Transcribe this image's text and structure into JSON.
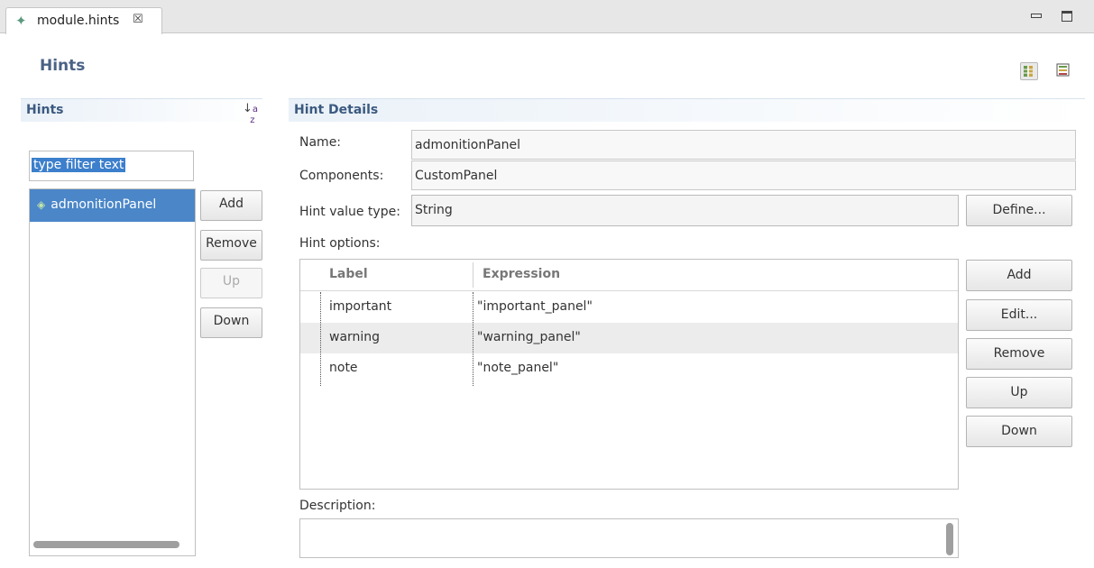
{
  "tab": {
    "icon": "diamond-icon",
    "label": "module.hints",
    "close_glyph": "☒"
  },
  "window_controls": {
    "minimize": "minimize-icon",
    "maximize": "maximize-icon"
  },
  "page": {
    "title": "Hints"
  },
  "hints_section": {
    "title": "Hints",
    "sort_icon": "sort-az-icon",
    "filter_text": "type filter text",
    "items": [
      {
        "label": "admonitionPanel",
        "icon": "green-diamond-icon",
        "selected": true
      }
    ],
    "buttons": {
      "add": "Add",
      "remove": "Remove",
      "up": "Up",
      "down": "Down"
    }
  },
  "details_section": {
    "title": "Hint Details",
    "name_label": "Name:",
    "name_value": "admonitionPanel",
    "components_label": "Components:",
    "components_value": "CustomPanel",
    "hint_value_type_label": "Hint value type:",
    "hint_value_type_value": "String",
    "define_button": "Define...",
    "hint_options_label": "Hint options:",
    "table": {
      "columns": [
        "Label",
        "Expression"
      ],
      "rows": [
        {
          "label": "important",
          "expression": "\"important_panel\""
        },
        {
          "label": "warning",
          "expression": "\"warning_panel\""
        },
        {
          "label": "note",
          "expression": "\"note_panel\""
        }
      ]
    },
    "option_buttons": {
      "add": "Add",
      "edit": "Edit...",
      "remove": "Remove",
      "up": "Up",
      "down": "Down"
    },
    "description_label": "Description:"
  },
  "colors": {
    "accent": "#4a86c8",
    "title": "#4a6285",
    "selection": "#3c7fcc"
  }
}
